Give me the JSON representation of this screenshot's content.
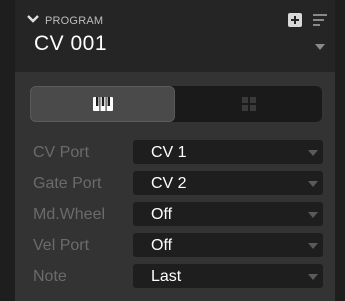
{
  "header": {
    "label": "PROGRAM",
    "program_name": "CV 001"
  },
  "mode_toggle": {
    "selected": "keyboard",
    "options": [
      "keyboard-icon",
      "grid-icon"
    ]
  },
  "settings": {
    "rows": [
      {
        "label": "CV Port",
        "value": "CV 1"
      },
      {
        "label": "Gate Port",
        "value": "CV 2"
      },
      {
        "label": "Md.Wheel",
        "value": "Off"
      },
      {
        "label": "Vel Port",
        "value": "Off"
      },
      {
        "label": "Note",
        "value": "Last"
      }
    ]
  },
  "colors": {
    "panel_bg": "#333333",
    "header_bg": "#252525",
    "select_bg": "#1e1e1e",
    "label_text": "#6b6b6b",
    "value_text": "#ffffff"
  }
}
